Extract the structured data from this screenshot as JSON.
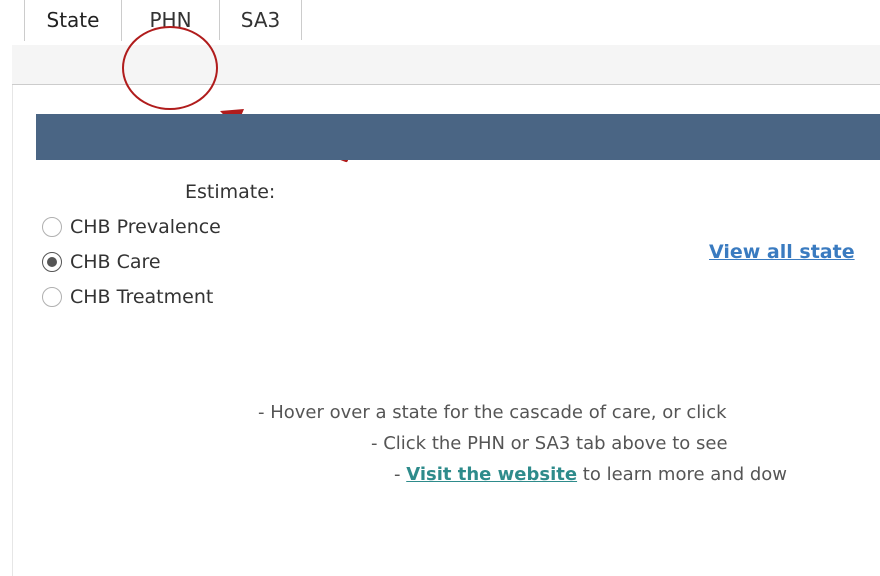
{
  "tabs": [
    {
      "label": "State",
      "active": true
    },
    {
      "label": "PHN",
      "active": false
    },
    {
      "label": "SA3",
      "active": false
    }
  ],
  "annotation": {
    "highlight_target": "PHN",
    "color": "#b01c1c"
  },
  "header_band": {
    "color": "#4a6584"
  },
  "estimate": {
    "label": "Estimate:",
    "options": [
      {
        "label": "CHB Prevalence",
        "selected": false
      },
      {
        "label": "CHB Care",
        "selected": true
      },
      {
        "label": "CHB Treatment",
        "selected": false
      }
    ]
  },
  "view_all_link": "View all state",
  "instructions": {
    "line1": "- Hover over a state for the cascade of care, or click",
    "line2": "- Click the PHN or SA3 tab above to see",
    "line3_prefix": "- ",
    "line3_link": "Visit the website",
    "line3_suffix": " to learn more and dow"
  },
  "colors": {
    "link_blue": "#3a7bc0",
    "link_teal": "#2e8b8b"
  }
}
